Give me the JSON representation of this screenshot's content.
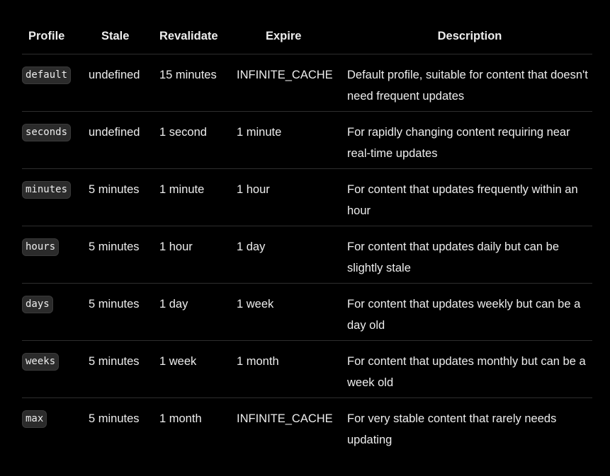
{
  "table": {
    "headers": {
      "profile": "Profile",
      "stale": "Stale",
      "revalidate": "Revalidate",
      "expire": "Expire",
      "description": "Description"
    },
    "rows": [
      {
        "profile": "default",
        "stale": "undefined",
        "revalidate": "15 minutes",
        "expire": "INFINITE_CACHE",
        "description": "Default profile, suitable for content that doesn't need frequent updates"
      },
      {
        "profile": "seconds",
        "stale": "undefined",
        "revalidate": "1 second",
        "expire": "1 minute",
        "description": "For rapidly changing content requiring near real-time updates"
      },
      {
        "profile": "minutes",
        "stale": "5 minutes",
        "revalidate": "1 minute",
        "expire": "1 hour",
        "description": "For content that updates frequently within an hour"
      },
      {
        "profile": "hours",
        "stale": "5 minutes",
        "revalidate": "1 hour",
        "expire": "1 day",
        "description": "For content that updates daily but can be slightly stale"
      },
      {
        "profile": "days",
        "stale": "5 minutes",
        "revalidate": "1 day",
        "expire": "1 week",
        "description": "For content that updates weekly but can be a day old"
      },
      {
        "profile": "weeks",
        "stale": "5 minutes",
        "revalidate": "1 week",
        "expire": "1 month",
        "description": "For content that updates monthly but can be a week old"
      },
      {
        "profile": "max",
        "stale": "5 minutes",
        "revalidate": "1 month",
        "expire": "INFINITE_CACHE",
        "description": "For very stable content that rarely needs updating"
      }
    ]
  },
  "colors": {
    "background": "#000000",
    "text": "#ededed",
    "divider": "#2e2e2e",
    "badge_background": "#2b2b2b",
    "badge_border": "#3a3a3a"
  }
}
